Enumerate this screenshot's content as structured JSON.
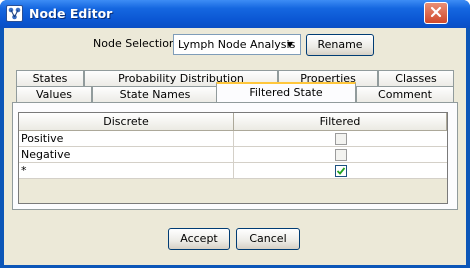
{
  "window": {
    "title": "Node Editor"
  },
  "selection": {
    "label": "Node Selection:",
    "value": "Lymph Node Analysis",
    "rename_label": "Rename"
  },
  "tabs_row1": [
    "States",
    "Probability Distribution",
    "Properties",
    "Classes"
  ],
  "tabs_row2": [
    "Values",
    "State Names",
    "Filtered State",
    "Comment"
  ],
  "active_tab": "Filtered State",
  "table": {
    "columns": [
      "Discrete",
      "Filtered"
    ],
    "rows": [
      {
        "name": "Positive",
        "filtered": false
      },
      {
        "name": "Negative",
        "filtered": false
      },
      {
        "name": "*",
        "filtered": true
      }
    ]
  },
  "footer": {
    "accept_label": "Accept",
    "cancel_label": "Cancel"
  },
  "icons": {
    "app": "node-editor-icon",
    "close": "close-icon",
    "dropdown": "chevron-down-icon"
  },
  "colors": {
    "titlebar": "#0b57d4",
    "tab_highlight": "#ffc73c",
    "check": "#21a121"
  }
}
